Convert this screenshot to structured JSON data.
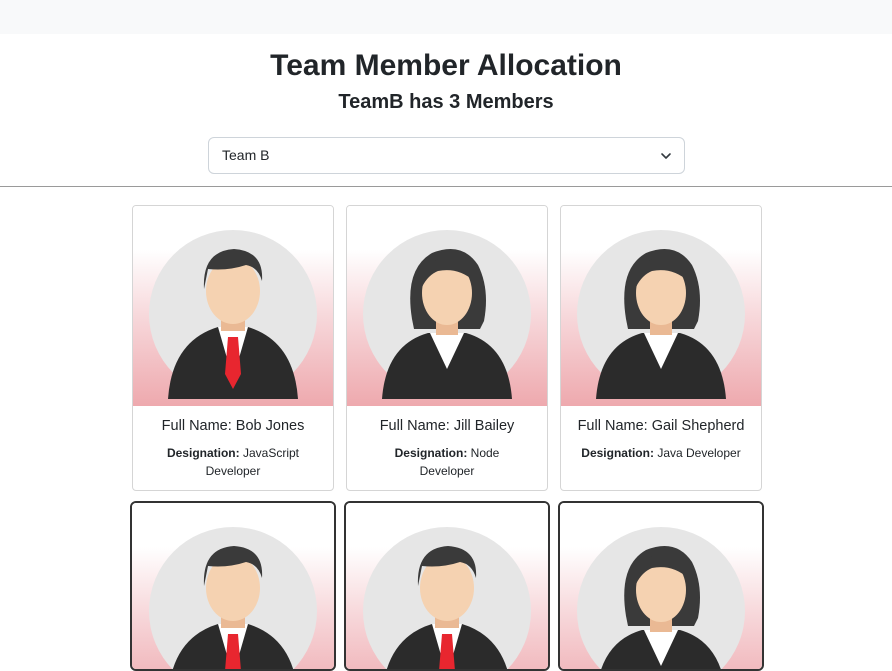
{
  "header": {
    "title": "Team Member Allocation",
    "subtitle": "TeamB has 3 Members"
  },
  "team_select": {
    "selected": "Team B",
    "icon": "chevron-down-icon"
  },
  "members": [
    {
      "full_name_label": "Full Name: Bob Jones",
      "designation_label": "Designation:",
      "designation": "JavaScript Developer",
      "avatar": "male-avatar"
    },
    {
      "full_name_label": "Full Name: Jill Bailey",
      "designation_label": "Designation:",
      "designation": "Node Developer",
      "avatar": "female-avatar"
    },
    {
      "full_name_label": "Full Name: Gail Shepherd",
      "designation_label": "Designation:",
      "designation": "Java Developer",
      "avatar": "female-avatar"
    }
  ],
  "second_row_avatars": [
    "male-avatar",
    "male-avatar",
    "female-avatar"
  ],
  "colors": {
    "topbar": "#f8f9fa",
    "card_gradient_bottom": "#eea9ae",
    "tie": "#e8262f",
    "suit": "#2b2b2b",
    "skin": "#f5d2b1",
    "hair": "#3a3a3a",
    "avatar_circle": "#e6e6e6"
  }
}
